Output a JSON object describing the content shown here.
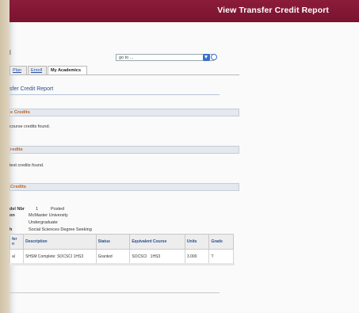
{
  "header": {
    "title": "View Transfer Credit Report",
    "bg_color": "#7f1733"
  },
  "stray_text": "l",
  "goto": {
    "value": "go to ..."
  },
  "tabs": [
    {
      "label": "Plan",
      "active": false
    },
    {
      "label": "Enroll",
      "active": false
    },
    {
      "label": "My Academics",
      "active": true
    }
  ],
  "page_title": "sfer Credit Report",
  "sections": {
    "course": {
      "title": "e Credits",
      "message": "course credits found."
    },
    "test": {
      "title": "redits",
      "message": "test credits found."
    },
    "other": {
      "title": "Credits"
    }
  },
  "details": {
    "model_nbr_label": "del Nbr",
    "model_nbr_value": "1",
    "status_value": "Posted",
    "institution_label": "on",
    "institution_value": "McMaster University",
    "career_value": "Undergraduate",
    "program_label": "h",
    "program_value": "Social Sciences Degree Seeking"
  },
  "table": {
    "headers": [
      "fer\nn",
      "Description",
      "Status",
      "Equivalent Course",
      "Units",
      "Grade"
    ],
    "rows": [
      [
        "al",
        "SHSM Complete: SOCSCI 1HS3",
        "Granted",
        "SOCSCI   1HS3",
        "3.000",
        "T"
      ]
    ]
  }
}
